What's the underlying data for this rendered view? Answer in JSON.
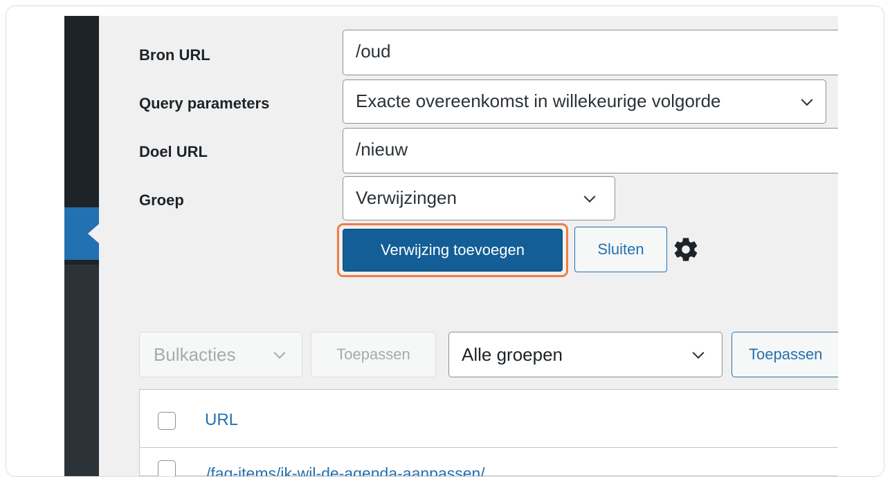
{
  "form": {
    "source_label": "Bron URL",
    "source_value": "/oud",
    "query_label": "Query parameters",
    "query_value": "Exacte overeenkomst in willekeurige volgorde",
    "target_label": "Doel URL",
    "target_value": "/nieuw",
    "group_label": "Groep",
    "group_value": "Verwijzingen",
    "add_button": "Verwijzing toevoegen",
    "close_button": "Sluiten",
    "settings_icon": "gear-icon"
  },
  "tablenav": {
    "bulk_actions": "Bulkacties",
    "apply_bulk": "Toepassen",
    "group_filter": "Alle groepen",
    "apply_filter": "Toepassen"
  },
  "table": {
    "column_url": "URL",
    "rows": [
      {
        "url": "/faq-items/ik-wil-de-agenda-aanpassen/"
      }
    ]
  },
  "colors": {
    "primary": "#135e96",
    "highlight": "#ef7d46",
    "link": "#2271b1",
    "sidebar": "#1d2327"
  }
}
